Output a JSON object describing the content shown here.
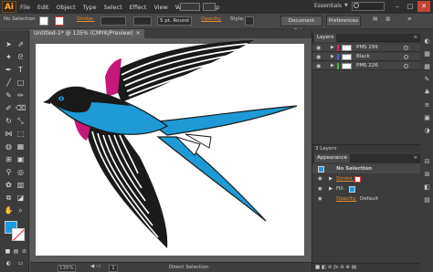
{
  "app": {
    "logo": "Ai",
    "workspace": "Essentials"
  },
  "menu": [
    "File",
    "Edit",
    "Object",
    "Type",
    "Select",
    "Effect",
    "View",
    "Help"
  ],
  "window_controls": {
    "minimize": "–",
    "maximize": "□",
    "close": "✕"
  },
  "control_bar": {
    "selection_label": "No Selection",
    "stroke_label": "Stroke:",
    "brush_value": "5 pt. Round",
    "opacity_label": "Opacity:",
    "style_label": "Style:",
    "document_setup": "Document Setup",
    "preferences": "Preferences"
  },
  "document": {
    "tab_title": "Untitled-1* @ 135% (CMYK/Preview)",
    "close": "✕"
  },
  "status_bar": {
    "zoom": "135%",
    "artboard_number": "1",
    "status_text": "Direct Selection"
  },
  "layers_panel": {
    "tab": "Layers",
    "menu": "≡",
    "layers": [
      {
        "name": "PMS 299",
        "color": "#e0207a"
      },
      {
        "name": "Black",
        "color": "#4060e0"
      },
      {
        "name": "PMS 226",
        "color": "#40c040"
      }
    ],
    "footer": "3 Layers"
  },
  "appearance_panel": {
    "tab": "Appearance",
    "menu": "≡",
    "header": "No Selection",
    "stroke_label": "Stroke:",
    "fill_label": "Fill:",
    "opacity_label": "Opacity:",
    "opacity_value": "Default"
  },
  "colors": {
    "bird_blue": "#1e9ad6",
    "bird_magenta": "#c51878",
    "bird_black": "#1a1a1a",
    "fill_swatch": "#1d9be0",
    "accent_orange": "#e48a2e"
  }
}
